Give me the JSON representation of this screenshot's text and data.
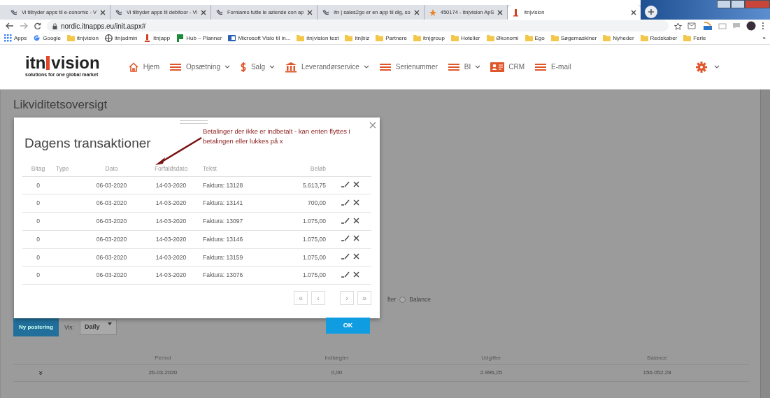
{
  "browser": {
    "tabs": [
      {
        "title": "Vi tilbyder apps til e-conomic - V",
        "kind": "swirl",
        "selected": false
      },
      {
        "title": "Vi tilbyder apps til debitoor - Vi",
        "kind": "swirl",
        "selected": false
      },
      {
        "title": "Forniamo tutte le aziende con ap",
        "kind": "swirl",
        "selected": false
      },
      {
        "title": "itn | sales2go er en app til dig, so",
        "kind": "swirl",
        "selected": false
      },
      {
        "title": "450174 - itn|vision ApS",
        "kind": "star",
        "selected": false
      },
      {
        "title": "itn|vision",
        "kind": "bar",
        "selected": true
      }
    ],
    "address": "nordic.itnapps.eu/init.aspx#",
    "bookmarks": [
      {
        "label": "Apps",
        "kind": "apps"
      },
      {
        "label": "Google",
        "kind": "google"
      },
      {
        "label": "itn|vision",
        "kind": "folder"
      },
      {
        "label": "itn|admin",
        "kind": "globe"
      },
      {
        "label": "itn|app",
        "kind": "bar"
      },
      {
        "label": "Hub – Planner",
        "kind": "flag"
      },
      {
        "label": "Microsoft Visio til in...",
        "kind": "visio"
      },
      {
        "label": "itn|vision test",
        "kind": "folder"
      },
      {
        "label": "itn|biz",
        "kind": "folder"
      },
      {
        "label": "Partnere",
        "kind": "folder"
      },
      {
        "label": "itn|group",
        "kind": "folder"
      },
      {
        "label": "Hoteller",
        "kind": "folder"
      },
      {
        "label": "Økonomi",
        "kind": "folder"
      },
      {
        "label": "Ego",
        "kind": "folder"
      },
      {
        "label": "Søgemaskiner",
        "kind": "folder"
      },
      {
        "label": "Nyheder",
        "kind": "folder"
      },
      {
        "label": "Redskaber",
        "kind": "folder"
      },
      {
        "label": "Ferie",
        "kind": "folder"
      }
    ],
    "bookmarks_more": "»"
  },
  "app": {
    "logo": {
      "brand_left": "itn",
      "brand_right": "vision",
      "tagline": "solutions for one global market"
    },
    "nav": [
      {
        "label": "Hjem",
        "kind": "home",
        "dropdown": false
      },
      {
        "label": "Opsætning",
        "kind": "menu",
        "dropdown": true
      },
      {
        "label": "Salg",
        "kind": "dollar",
        "dropdown": true
      },
      {
        "label": "Leverandørservice",
        "kind": "bank",
        "dropdown": true
      },
      {
        "label": "Serienummer",
        "kind": "menu",
        "dropdown": false
      },
      {
        "label": "BI",
        "kind": "menu",
        "dropdown": true
      },
      {
        "label": "CRM",
        "kind": "card",
        "dropdown": false
      },
      {
        "label": "E-mail",
        "kind": "menu",
        "dropdown": false
      }
    ],
    "settings_dropdown": true
  },
  "page": {
    "title": "Likviditetsoversigt",
    "view_options": [
      {
        "label": "fter",
        "kind": "label"
      },
      {
        "label": "Balance",
        "kind": "radio",
        "selected": false
      }
    ],
    "new_button": "Ny postering",
    "view_label": "Vis:",
    "view_select": "Daily",
    "table": {
      "columns": [
        "Period",
        "Indtægter",
        "Udgifter",
        "Balance"
      ],
      "rows": [
        {
          "expand": "»",
          "cells": [
            "26-03-2020",
            "0,00",
            "2.996,25",
            "156.052,28"
          ]
        }
      ]
    }
  },
  "modal": {
    "title": "Dagens transaktioner",
    "annotation": "Betalinger der ikke er indbetalt - kan enten flyttes i betalingen eller lukkes på x",
    "columns": [
      "Bitag",
      "Type",
      "Dato",
      "Forfaldsdato",
      "Tekst",
      "Beløb"
    ],
    "rows": [
      {
        "bilag": "0",
        "type": "",
        "dato": "06-03-2020",
        "forfald": "14-03-2020",
        "tekst": "Faktura: 13128",
        "belob": "5.613,75"
      },
      {
        "bilag": "0",
        "type": "",
        "dato": "06-03-2020",
        "forfald": "14-03-2020",
        "tekst": "Faktura: 13141",
        "belob": "700,00"
      },
      {
        "bilag": "0",
        "type": "",
        "dato": "06-03-2020",
        "forfald": "14-03-2020",
        "tekst": "Faktura: 13097",
        "belob": "1.075,00"
      },
      {
        "bilag": "0",
        "type": "",
        "dato": "06-03-2020",
        "forfald": "14-03-2020",
        "tekst": "Faktura: 13146",
        "belob": "1.075,00"
      },
      {
        "bilag": "0",
        "type": "",
        "dato": "06-03-2020",
        "forfald": "14-03-2020",
        "tekst": "Faktura: 13159",
        "belob": "1.075,00"
      },
      {
        "bilag": "0",
        "type": "",
        "dato": "06-03-2020",
        "forfald": "14-03-2020",
        "tekst": "Faktura: 13076",
        "belob": "1.075,00"
      }
    ],
    "pager": [
      {
        "label": "«",
        "kind": "first"
      },
      {
        "label": "‹",
        "kind": "prev"
      },
      {
        "label": "›",
        "kind": "next"
      },
      {
        "label": "»",
        "kind": "last"
      }
    ],
    "ok": "OK"
  }
}
